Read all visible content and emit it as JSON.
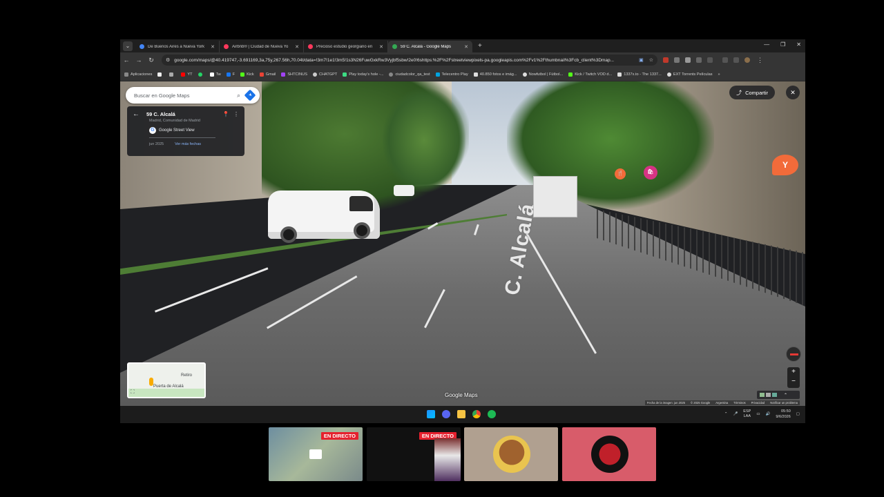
{
  "browser": {
    "tabs": [
      {
        "title": "De Buenos Aires a Nueva York",
        "color": "#4285f4"
      },
      {
        "title": "Airbnb® | Ciudad de Nueva Yo",
        "color": "#ff385c"
      },
      {
        "title": "Precioso estudio georgiano en",
        "color": "#ff385c"
      },
      {
        "title": "59 C. Alcalá - Google Maps",
        "color": "#34a853"
      }
    ],
    "url": "google.com/maps/@40.419747,-3.691169,3a,75y,267.56h,70.04t/data=!3m7!1e1!3m5!1s3N26FuwGxkRw3Vyjbf5sbw!2e0!6shttps:%2F%2Fstreetviewpixels-pa.googleapis.com%2Fv1%2Fthumbnail%3Fcb_client%3Dmap..."
  },
  "bookmarks": [
    {
      "label": "Aplicaciones",
      "color": "#888"
    },
    {
      "label": "YT",
      "color": "#ff0000"
    },
    {
      "label": "Tw",
      "color": "#fff"
    },
    {
      "label": "F",
      "color": "#1877f2"
    },
    {
      "label": "Kick",
      "color": "#53fc18"
    },
    {
      "label": "Gmail",
      "color": "#ea4335"
    },
    {
      "label": "SHTCINUS",
      "color": "#a142f4"
    },
    {
      "label": "CHATGPT",
      "color": "#ccc"
    },
    {
      "label": "Play today's hole -...",
      "color": "#3ddc84"
    },
    {
      "label": "ciudadcolor_qa_test",
      "color": "#888"
    },
    {
      "label": "Telecentro Play",
      "color": "#00a3e0"
    },
    {
      "label": "40.850 fotos e imág...",
      "color": "#ddd"
    },
    {
      "label": "Nowfutbol | Fútbol...",
      "color": "#ddd"
    },
    {
      "label": "Kick / Twitch VOD d...",
      "color": "#53fc18"
    },
    {
      "label": "1337x.to - The 1337...",
      "color": "#ddd"
    },
    {
      "label": "EXT Torrents Películas",
      "color": "#ddd"
    }
  ],
  "maps": {
    "search_placeholder": "Buscar en Google Maps",
    "place_title": "59 C. Alcalá",
    "place_subtitle": "Madrid, Comunidad de Madrid",
    "source": "Google Street View",
    "capture_date": "jun 2025",
    "more_dates": "Ver más fechas",
    "share_label": "Compartir",
    "road_label": "C. Alcalá",
    "minimap_labels": [
      "Retiro",
      "Puerta de Alcalá"
    ],
    "logo_text": "Google Maps",
    "attribution": [
      "Fecha de la imagen: jun 2025",
      "© 2025 Google",
      "Argentina",
      "Términos",
      "Privacidad",
      "Notificar un problema"
    ]
  },
  "taskbar": {
    "lang": "ESP",
    "lang_sub": "LAA",
    "time": "05:50",
    "date": "9/6/2026"
  },
  "thumbnails": {
    "live_label": "EN DIRECTO"
  }
}
